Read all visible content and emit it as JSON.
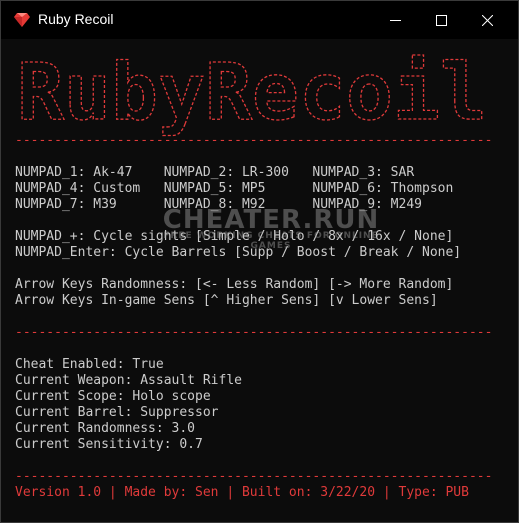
{
  "window": {
    "title": "Ruby Recoil",
    "icon": "ruby-gem-icon",
    "buttons": [
      "minimize-icon",
      "maximize-icon",
      "close-icon"
    ]
  },
  "banner": {
    "text": "RubyRecoil",
    "color": "#e03a3a"
  },
  "separator": "-------------------------------------------------------------",
  "keys": {
    "row1": "NUMPAD_1: Ak-47    NUMPAD_2: LR-300   NUMPAD_3: SAR",
    "row2": "NUMPAD_4: Custom   NUMPAD_5: MP5      NUMPAD_6: Thompson",
    "row3": "NUMPAD_7: M39      NUMPAD_8: M92      NUMPAD_9: M249",
    "plus": "NUMPAD_+: Cycle sights [Simple / Holo / 8x / 16x / None]",
    "enter": "NUMPAD_Enter: Cycle Barrels [Supp / Boost / Break / None]",
    "arrows_random": "Arrow Keys Randomness: [<- Less Random] [-> More Random]",
    "arrows_sens": "Arrow Keys In-game Sens [^ Higher Sens] [v Lower Sens]"
  },
  "status": {
    "enabled": "Cheat Enabled: True",
    "weapon": "Current Weapon: Assault Rifle",
    "scope": "Current Scope: Holo scope",
    "barrel": "Current Barrel: Suppressor",
    "randomness": "Current Randomness: 3.0",
    "sensitivity": "Current Sensitivity: 0.7"
  },
  "footer": "Version 1.0 | Made by: Sen | Built on: 3/22/20 | Type: PUB",
  "watermark": {
    "main": "CHEATER.RUN",
    "sub": "FREE WORKING CHEATS FOR ONLINE GAMES"
  },
  "colors": {
    "accent": "#e03a3a",
    "text": "#cccccc",
    "background": "#0c0c0c"
  }
}
